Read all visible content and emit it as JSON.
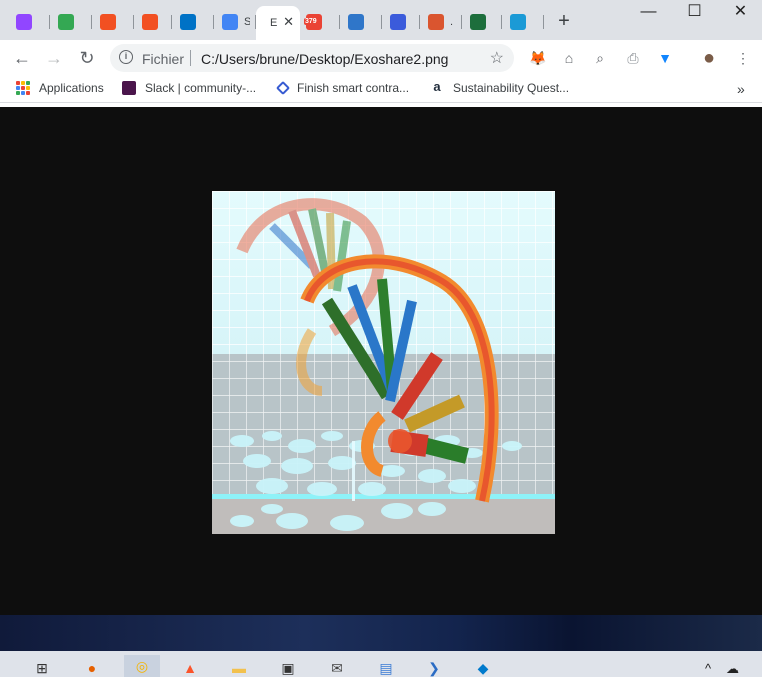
{
  "tabs": [
    {
      "icon": "twitch-icon",
      "label": "",
      "color": "#9146ff"
    },
    {
      "icon": "maps-icon",
      "label": "",
      "color": "#34a853"
    },
    {
      "icon": "microsoft-icon",
      "label": "",
      "color": "#f25022"
    },
    {
      "icon": "microsoft-icon",
      "label": "",
      "color": "#f25022"
    },
    {
      "icon": "outlook-icon",
      "label": "",
      "color": "#0072c6"
    },
    {
      "icon": "google-icon",
      "label": "S",
      "color": "#4285f4"
    },
    {
      "icon": "file-icon",
      "label": "E",
      "color": "#ffffff",
      "active": true
    },
    {
      "icon": "calendar-icon",
      "label": "",
      "color": "#ea4335",
      "badge": "379"
    },
    {
      "icon": "bitcoin-icon",
      "label": "",
      "color": "#2f76c9"
    },
    {
      "icon": "infinity-icon",
      "label": "",
      "color": "#3b5bdb"
    },
    {
      "icon": "producthunt-icon",
      "label": ".",
      "color": "#da552f"
    },
    {
      "icon": "game-icon",
      "label": "",
      "color": "#1d6e3c"
    },
    {
      "icon": "hex-icon",
      "label": "",
      "color": "#1b9ad6"
    }
  ],
  "active_tab_close": "✕",
  "new_tab": "+",
  "window_controls": {
    "minimize": "—",
    "maximize": "☐",
    "close": "✕"
  },
  "toolbar": {
    "back": "←",
    "forward": "→",
    "reload": "↻",
    "info": "i",
    "scheme_label": "Fichier",
    "url": "C:/Users/brune/Desktop/Exoshare2.png",
    "star": "☆"
  },
  "extensions": [
    {
      "name": "metamask-icon",
      "glyph": "🦊"
    },
    {
      "name": "home-icon",
      "glyph": "⌂"
    },
    {
      "name": "search-icon",
      "glyph": "⌕"
    },
    {
      "name": "pdf-icon",
      "glyph": "⎙"
    },
    {
      "name": "bluesky-icon",
      "glyph": "▼"
    },
    {
      "name": "avatar-icon",
      "glyph": "●"
    },
    {
      "name": "menu-icon",
      "glyph": "⋮"
    }
  ],
  "bookmarks": [
    {
      "label": "Applications",
      "icon": "apps-grid-icon"
    },
    {
      "label": "Slack | community-...",
      "icon": "slack-icon",
      "color": "#4a154b"
    },
    {
      "label": "Finish smart contra...",
      "icon": "chainlink-icon",
      "color": "#375bd2"
    },
    {
      "label": "Sustainability Quest...",
      "icon": "amazon-icon",
      "color": "#232f3e"
    }
  ],
  "bookmarks_overflow": "»",
  "image": {
    "alt": "Exoshare2.png"
  },
  "taskbar": {
    "items": [
      {
        "name": "task-view-icon",
        "glyph": "⊞"
      },
      {
        "name": "firefox-icon",
        "glyph": "●"
      },
      {
        "name": "chrome-icon",
        "glyph": "◎"
      },
      {
        "name": "brave-icon",
        "glyph": "▲"
      },
      {
        "name": "file-explorer-icon",
        "glyph": "▬"
      },
      {
        "name": "store-icon",
        "glyph": "▣"
      },
      {
        "name": "mail-icon",
        "glyph": "✉"
      },
      {
        "name": "notepad-icon",
        "glyph": "▤"
      },
      {
        "name": "powershell-icon",
        "glyph": "❯"
      },
      {
        "name": "vscode-icon",
        "glyph": "◆"
      }
    ],
    "tray_up": "^",
    "tray_cloud": "☁"
  }
}
